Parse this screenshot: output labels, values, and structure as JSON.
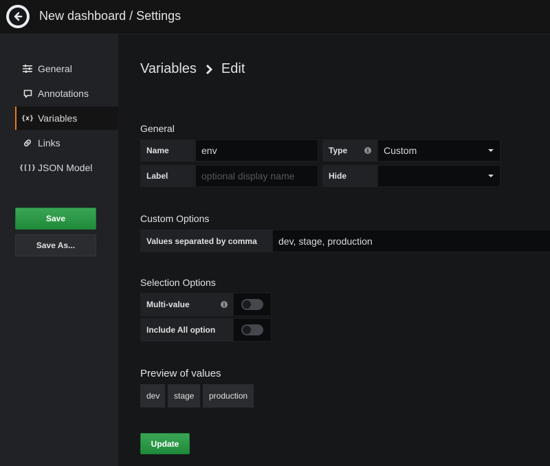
{
  "header": {
    "title": "New dashboard / Settings",
    "back_icon": "arrow-left-circle-icon"
  },
  "sidebar": {
    "items": [
      {
        "label": "General",
        "icon": "sliders-icon",
        "active": false
      },
      {
        "label": "Annotations",
        "icon": "comment-icon",
        "active": false
      },
      {
        "label": "Variables",
        "icon": "variable-icon",
        "icon_text": "{x}",
        "active": true
      },
      {
        "label": "Links",
        "icon": "link-icon",
        "active": false
      },
      {
        "label": "JSON Model",
        "icon": "json-icon",
        "icon_text": "{[]}",
        "active": false
      }
    ],
    "save_label": "Save",
    "save_as_label": "Save As..."
  },
  "page": {
    "breadcrumb_parent": "Variables",
    "breadcrumb_current": "Edit"
  },
  "general": {
    "title": "General",
    "name_label": "Name",
    "name_value": "env",
    "type_label": "Type",
    "type_value": "Custom",
    "label_label": "Label",
    "label_placeholder": "optional display name",
    "hide_label": "Hide",
    "hide_value": ""
  },
  "custom_options": {
    "title": "Custom Options",
    "values_label": "Values separated by comma",
    "values_value": "dev, stage, production"
  },
  "selection_options": {
    "title": "Selection Options",
    "multi_value_label": "Multi-value",
    "multi_value_enabled": false,
    "include_all_label": "Include All option",
    "include_all_enabled": false
  },
  "preview": {
    "title": "Preview of values",
    "values": [
      "dev",
      "stage",
      "production"
    ]
  },
  "update_label": "Update",
  "colors": {
    "accent_active": "#eb7b18",
    "primary_button": "#299c46"
  }
}
